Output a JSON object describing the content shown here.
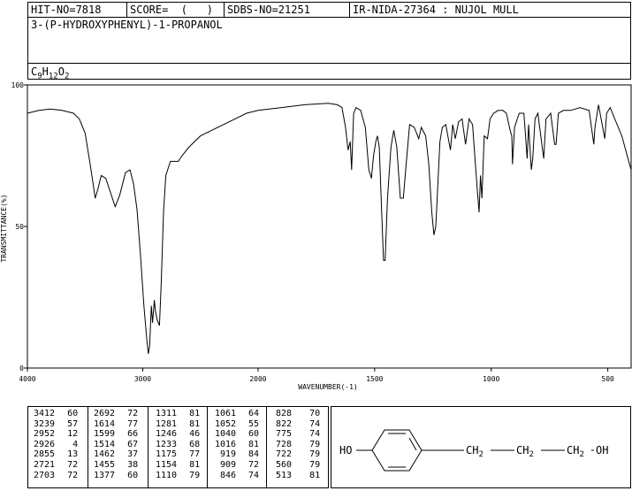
{
  "header": {
    "hit_no": "HIT-NO=7818",
    "score": "SCORE=  (   )",
    "sdbs_no": "SDBS-NO=21251",
    "ir_nida": "IR-NIDA-27364 : NUJOL MULL",
    "compound_name": "3-(P-HYDROXYPHENYL)-1-PROPANOL",
    "formula_parts": [
      "C",
      "9",
      "H",
      "12",
      "O",
      "2"
    ]
  },
  "chart_data": {
    "type": "line",
    "xlabel": "WAVENUMBER(-1)",
    "ylabel": "TRANSMITTANCE(%)",
    "xlim": [
      4000,
      400
    ],
    "ylim": [
      0,
      100
    ],
    "x_ticks": [
      4000,
      3000,
      2000,
      1500,
      1000,
      500
    ],
    "y_ticks": [
      0,
      50,
      100
    ],
    "grid": false,
    "series": [
      {
        "color": "#000000",
        "points": [
          [
            4000,
            90
          ],
          [
            3900,
            91
          ],
          [
            3800,
            91.5
          ],
          [
            3700,
            91
          ],
          [
            3600,
            90
          ],
          [
            3550,
            88
          ],
          [
            3500,
            83
          ],
          [
            3460,
            73
          ],
          [
            3430,
            65
          ],
          [
            3412,
            60
          ],
          [
            3390,
            63
          ],
          [
            3360,
            68
          ],
          [
            3320,
            67
          ],
          [
            3280,
            62
          ],
          [
            3239,
            57
          ],
          [
            3200,
            61
          ],
          [
            3150,
            69
          ],
          [
            3110,
            70
          ],
          [
            3080,
            65
          ],
          [
            3050,
            56
          ],
          [
            3020,
            40
          ],
          [
            2990,
            22
          ],
          [
            2965,
            10
          ],
          [
            2952,
            5
          ],
          [
            2940,
            8
          ],
          [
            2926,
            22
          ],
          [
            2915,
            16
          ],
          [
            2900,
            24
          ],
          [
            2890,
            20
          ],
          [
            2875,
            17
          ],
          [
            2855,
            15
          ],
          [
            2840,
            30
          ],
          [
            2820,
            55
          ],
          [
            2800,
            68
          ],
          [
            2760,
            73
          ],
          [
            2721,
            73
          ],
          [
            2703,
            73
          ],
          [
            2692,
            73
          ],
          [
            2660,
            75
          ],
          [
            2600,
            78
          ],
          [
            2500,
            82
          ],
          [
            2400,
            84
          ],
          [
            2300,
            86
          ],
          [
            2200,
            88
          ],
          [
            2100,
            90
          ],
          [
            2000,
            91
          ],
          [
            1900,
            92
          ],
          [
            1800,
            93
          ],
          [
            1700,
            93.5
          ],
          [
            1660,
            93
          ],
          [
            1640,
            92
          ],
          [
            1625,
            85
          ],
          [
            1614,
            77
          ],
          [
            1605,
            80
          ],
          [
            1599,
            70
          ],
          [
            1590,
            90
          ],
          [
            1580,
            92
          ],
          [
            1560,
            91
          ],
          [
            1540,
            85
          ],
          [
            1525,
            70
          ],
          [
            1514,
            67
          ],
          [
            1505,
            75
          ],
          [
            1495,
            80
          ],
          [
            1488,
            82
          ],
          [
            1480,
            78
          ],
          [
            1470,
            55
          ],
          [
            1462,
            38
          ],
          [
            1455,
            38
          ],
          [
            1445,
            60
          ],
          [
            1430,
            78
          ],
          [
            1418,
            84
          ],
          [
            1405,
            78
          ],
          [
            1390,
            60
          ],
          [
            1377,
            60
          ],
          [
            1365,
            72
          ],
          [
            1350,
            86
          ],
          [
            1330,
            85
          ],
          [
            1311,
            81
          ],
          [
            1300,
            85
          ],
          [
            1281,
            82
          ],
          [
            1268,
            72
          ],
          [
            1255,
            55
          ],
          [
            1246,
            47
          ],
          [
            1238,
            50
          ],
          [
            1233,
            58
          ],
          [
            1220,
            80
          ],
          [
            1210,
            85
          ],
          [
            1195,
            86
          ],
          [
            1175,
            77
          ],
          [
            1165,
            86
          ],
          [
            1154,
            81
          ],
          [
            1140,
            87
          ],
          [
            1125,
            88
          ],
          [
            1110,
            79
          ],
          [
            1095,
            88
          ],
          [
            1080,
            86
          ],
          [
            1061,
            64
          ],
          [
            1052,
            55
          ],
          [
            1046,
            68
          ],
          [
            1040,
            60
          ],
          [
            1030,
            82
          ],
          [
            1016,
            81
          ],
          [
            1005,
            88
          ],
          [
            990,
            90
          ],
          [
            970,
            91
          ],
          [
            950,
            91
          ],
          [
            935,
            90
          ],
          [
            919,
            84
          ],
          [
            912,
            82
          ],
          [
            909,
            72
          ],
          [
            900,
            85
          ],
          [
            880,
            90
          ],
          [
            860,
            90
          ],
          [
            846,
            74
          ],
          [
            840,
            86
          ],
          [
            828,
            70
          ],
          [
            822,
            74
          ],
          [
            812,
            88
          ],
          [
            800,
            90
          ],
          [
            775,
            74
          ],
          [
            765,
            88
          ],
          [
            745,
            90
          ],
          [
            728,
            79
          ],
          [
            722,
            79
          ],
          [
            712,
            90
          ],
          [
            690,
            91
          ],
          [
            660,
            91
          ],
          [
            620,
            92
          ],
          [
            580,
            91
          ],
          [
            560,
            79
          ],
          [
            555,
            85
          ],
          [
            540,
            93
          ],
          [
            513,
            81
          ],
          [
            505,
            90
          ],
          [
            490,
            92
          ],
          [
            470,
            88
          ],
          [
            440,
            82
          ],
          [
            420,
            76
          ],
          [
            400,
            70
          ]
        ]
      }
    ]
  },
  "peak_table": {
    "columns": [
      [
        [
          "3412",
          "60"
        ],
        [
          "3239",
          "57"
        ],
        [
          "2952",
          "12"
        ],
        [
          "2926",
          "4"
        ],
        [
          "2855",
          "13"
        ],
        [
          "2721",
          "72"
        ],
        [
          "2703",
          "72"
        ]
      ],
      [
        [
          "2692",
          "72"
        ],
        [
          "1614",
          "77"
        ],
        [
          "1599",
          "66"
        ],
        [
          "1514",
          "67"
        ],
        [
          "1462",
          "37"
        ],
        [
          "1455",
          "38"
        ],
        [
          "1377",
          "60"
        ]
      ],
      [
        [
          "1311",
          "81"
        ],
        [
          "1281",
          "81"
        ],
        [
          "1246",
          "46"
        ],
        [
          "1233",
          "68"
        ],
        [
          "1175",
          "77"
        ],
        [
          "1154",
          "81"
        ],
        [
          "1110",
          "79"
        ]
      ],
      [
        [
          "1061",
          "64"
        ],
        [
          "1052",
          "55"
        ],
        [
          "1040",
          "60"
        ],
        [
          "1016",
          "81"
        ],
        [
          "919",
          "84"
        ],
        [
          "909",
          "72"
        ],
        [
          "846",
          "74"
        ]
      ],
      [
        [
          "828",
          "70"
        ],
        [
          "822",
          "74"
        ],
        [
          "775",
          "74"
        ],
        [
          "728",
          "79"
        ],
        [
          "722",
          "79"
        ],
        [
          "560",
          "79"
        ],
        [
          "513",
          "81"
        ]
      ]
    ]
  },
  "structure": {
    "ho": "HO",
    "ch2": "CH",
    "sub2": "2",
    "oh": "OH"
  }
}
